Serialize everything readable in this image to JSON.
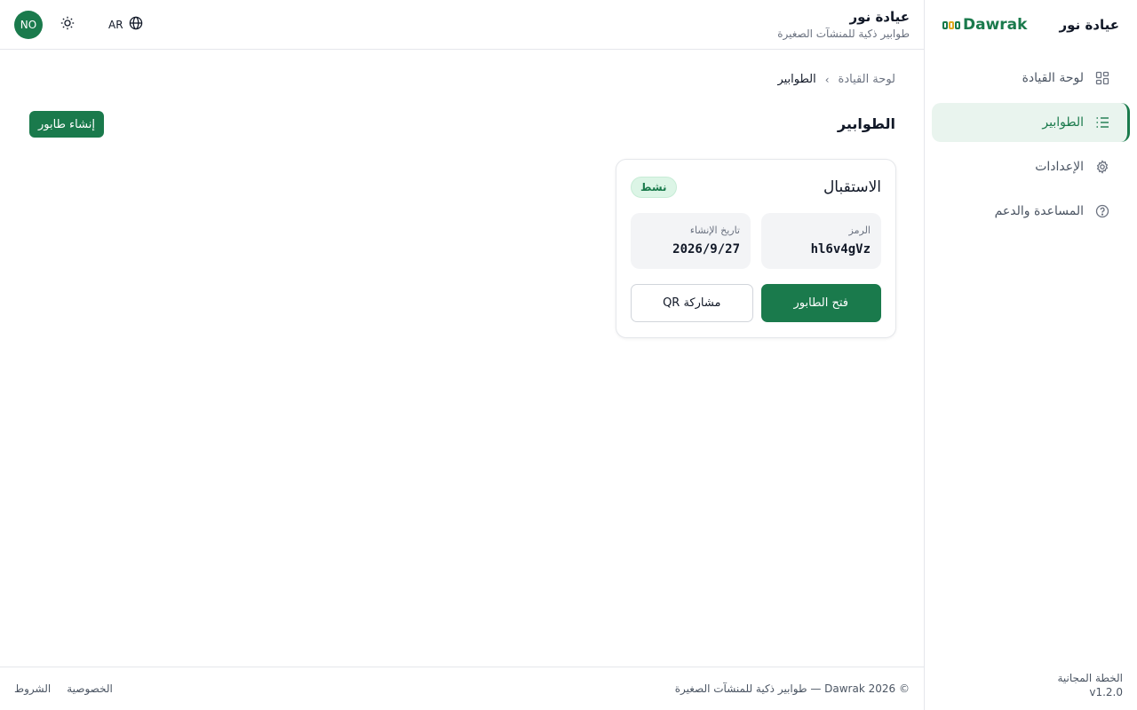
{
  "brand": {
    "logo_text": "Dawrak",
    "org_name": "عيادة نور"
  },
  "header": {
    "org_name": "عيادة نور",
    "org_tagline": "طوابير ذكية للمنشآت الصغيرة",
    "lang_label": "AR",
    "avatar_initials": "NO"
  },
  "sidebar": {
    "items": [
      {
        "label": "لوحة القيادة",
        "icon": "dashboard-grid-icon",
        "active": false
      },
      {
        "label": "الطوابير",
        "icon": "list-icon",
        "active": true
      },
      {
        "label": "الإعدادات",
        "icon": "gear-icon",
        "active": false
      },
      {
        "label": "المساعدة والدعم",
        "icon": "help-circle-icon",
        "active": false
      }
    ],
    "plan": "الخطة المجانية",
    "version": "v1.2.0"
  },
  "breadcrumb": {
    "root": "لوحة القيادة",
    "current": "الطوابير"
  },
  "main": {
    "title": "الطوابير",
    "create_label": "إنشاء طابور"
  },
  "queue_card": {
    "title": "الاستقبال",
    "status": "نشط",
    "code_label": "الرمز",
    "code_value": "hl6v4gVz",
    "date_label": "تاريخ الإنشاء",
    "date_value": "2026/9/27",
    "open_label": "فتح الطابور",
    "share_label": "مشاركة QR"
  },
  "footer": {
    "copyright": "© 2026 Dawrak — طوابير ذكية للمنشآت الصغيرة",
    "privacy": "الخصوصية",
    "terms": "الشروط"
  },
  "colors": {
    "accent": "#1a7a4c",
    "accent_light": "#e9f4ee",
    "border": "#e5e7eb"
  }
}
